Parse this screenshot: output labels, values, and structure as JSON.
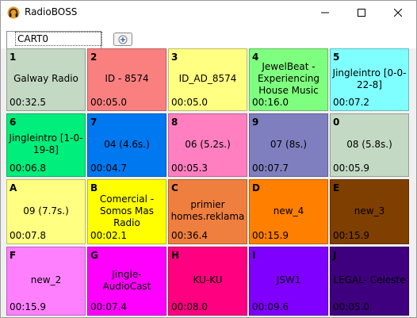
{
  "window": {
    "title": "RadioBOSS",
    "icon": "headphones-app-icon",
    "controls": [
      "minimize-icon",
      "maximize-icon",
      "close-icon"
    ]
  },
  "tabs": {
    "active": "CART0",
    "add_icon": "add-tab-icon"
  },
  "cells": [
    {
      "key": "1",
      "name": "Galway Radio",
      "duration": "00:32.5",
      "bg": "#c3d9c3",
      "fg": "#000000"
    },
    {
      "key": "2",
      "name": "ID - 8574",
      "duration": "00:05.0",
      "bg": "#fa8080",
      "fg": "#000000"
    },
    {
      "key": "3",
      "name": "ID_AD_8574",
      "duration": "00:05.0",
      "bg": "#ffff82",
      "fg": "#000000"
    },
    {
      "key": "4",
      "name": "JewelBeat - Experiencing House Music",
      "duration": "00:16.0",
      "bg": "#7fff7f",
      "fg": "#000000"
    },
    {
      "key": "5",
      "name": "Jingleintro [0-0-22-8]",
      "duration": "00:07.2",
      "bg": "#7fffff",
      "fg": "#000000"
    },
    {
      "key": "6",
      "name": "Jingleintro [1-0-19-8]",
      "duration": "00:06.8",
      "bg": "#00ee7c",
      "fg": "#000000"
    },
    {
      "key": "7",
      "name": "04 (4.6s.)",
      "duration": "00:04.7",
      "bg": "#0078f0",
      "fg": "#000000"
    },
    {
      "key": "8",
      "name": "06 (5.2s.)",
      "duration": "00:05.3",
      "bg": "#ff7fc0",
      "fg": "#000000"
    },
    {
      "key": "9",
      "name": "07 (8s.)",
      "duration": "00:07.7",
      "bg": "#7f7fbf",
      "fg": "#000000"
    },
    {
      "key": "0",
      "name": "08 (5.8s.)",
      "duration": "00:05.9",
      "bg": "#c3d9c3",
      "fg": "#000000"
    },
    {
      "key": "A",
      "name": "09 (7.7s.)",
      "duration": "00:07.8",
      "bg": "#ffff82",
      "fg": "#000000"
    },
    {
      "key": "B",
      "name": "Comercial - Somos Mas Radio",
      "duration": "00:02.1",
      "bg": "#ffff00",
      "fg": "#000000"
    },
    {
      "key": "C",
      "name": "primier homes.reklama",
      "duration": "00:36.4",
      "bg": "#ef7f3f",
      "fg": "#000000"
    },
    {
      "key": "D",
      "name": "new_4",
      "duration": "00:15.9",
      "bg": "#ff7f00",
      "fg": "#000000"
    },
    {
      "key": "E",
      "name": "new_3",
      "duration": "00:15.9",
      "bg": "#7f3f00",
      "fg": "#000000"
    },
    {
      "key": "F",
      "name": "new_2",
      "duration": "00:15.9",
      "bg": "#ff80ff",
      "fg": "#000000"
    },
    {
      "key": "G",
      "name": "Jingle-AudioCast",
      "duration": "00:07.4",
      "bg": "#ff00ff",
      "fg": "#000000"
    },
    {
      "key": "H",
      "name": "KU-KU",
      "duration": "00:08.0",
      "bg": "#ff0080",
      "fg": "#000000"
    },
    {
      "key": "I",
      "name": "JSW1",
      "duration": "00:09.6",
      "bg": "#7f00ff",
      "fg": "#000000"
    },
    {
      "key": "J",
      "name": "LEGAL- Celeste",
      "duration": "00:05.0",
      "bg": "#3f007f",
      "fg": "#000000"
    }
  ]
}
